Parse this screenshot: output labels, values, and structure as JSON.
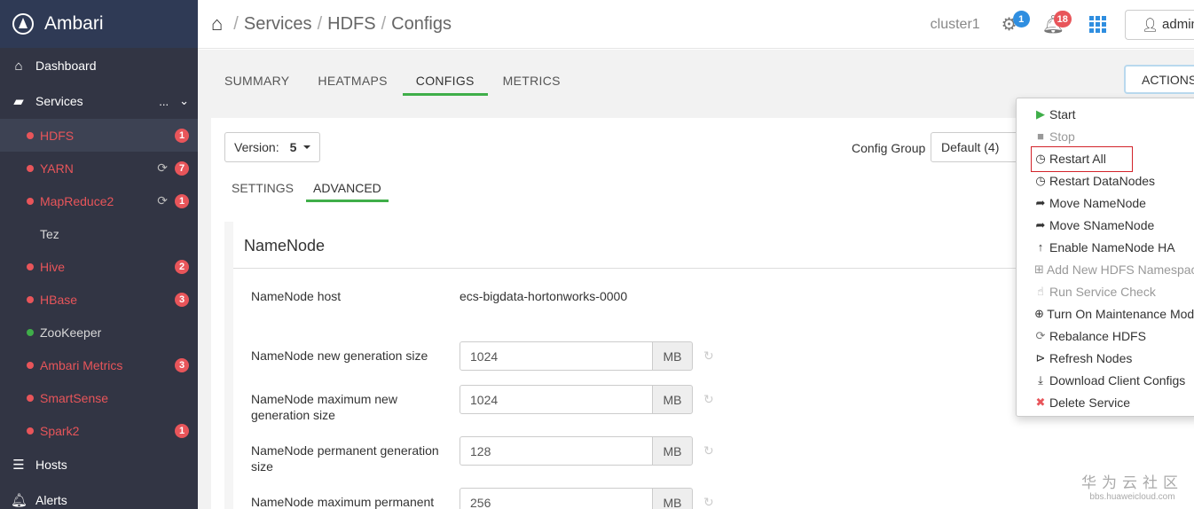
{
  "brand": {
    "name": "Ambari"
  },
  "sidebar": {
    "dashboard": "Dashboard",
    "services": "Services",
    "services_more": "...",
    "hosts": "Hosts",
    "alerts": "Alerts",
    "items": [
      {
        "name": "HDFS",
        "badge": "1",
        "refresh": false
      },
      {
        "name": "YARN",
        "badge": "7",
        "refresh": true
      },
      {
        "name": "MapReduce2",
        "badge": "1",
        "refresh": true
      },
      {
        "name": "Tez",
        "badge": "",
        "refresh": false
      },
      {
        "name": "Hive",
        "badge": "2",
        "refresh": false
      },
      {
        "name": "HBase",
        "badge": "3",
        "refresh": false
      },
      {
        "name": "ZooKeeper",
        "badge": "",
        "refresh": false
      },
      {
        "name": "Ambari Metrics",
        "badge": "3",
        "refresh": false
      },
      {
        "name": "SmartSense",
        "badge": "",
        "refresh": false
      },
      {
        "name": "Spark2",
        "badge": "1",
        "refresh": false
      }
    ]
  },
  "header": {
    "crumbs": [
      "Services",
      "HDFS",
      "Configs"
    ],
    "cluster": "cluster1",
    "ops_count": "1",
    "alerts_count": "18",
    "user": "admin"
  },
  "tabs": [
    "SUMMARY",
    "HEATMAPS",
    "CONFIGS",
    "METRICS"
  ],
  "actions_label": "ACTIONS",
  "version": {
    "label": "Version:",
    "value": "5"
  },
  "config_group": {
    "label": "Config Group",
    "value": "Default (4)"
  },
  "subtabs": [
    "SETTINGS",
    "ADVANCED"
  ],
  "section": {
    "title": "NameNode",
    "host_label": "NameNode host",
    "host_value": "ecs-bigdata-hortonworks-0000",
    "fields": [
      {
        "label": "NameNode new generation size",
        "value": "1024",
        "unit": "MB"
      },
      {
        "label": "NameNode maximum new generation size",
        "value": "1024",
        "unit": "MB"
      },
      {
        "label": "NameNode permanent generation size",
        "value": "128",
        "unit": "MB"
      },
      {
        "label": "NameNode maximum permanent",
        "value": "256",
        "unit": "MB"
      }
    ]
  },
  "menu": [
    "Start",
    "Stop",
    "Restart All",
    "Restart DataNodes",
    "Move NameNode",
    "Move SNameNode",
    "Enable NameNode HA",
    "Add New HDFS Namespace",
    "Run Service Check",
    "Turn On Maintenance Mode",
    "Rebalance HDFS",
    "Refresh Nodes",
    "Download Client Configs",
    "Delete Service"
  ],
  "watermark": {
    "cn": "华为云社区",
    "url": "bbs.huaweicloud.com"
  },
  "colors": {
    "sidebar": "#323544",
    "alert_red": "#e8555a",
    "ok_green": "#3fae49",
    "link_blue": "#2f8ee0"
  }
}
